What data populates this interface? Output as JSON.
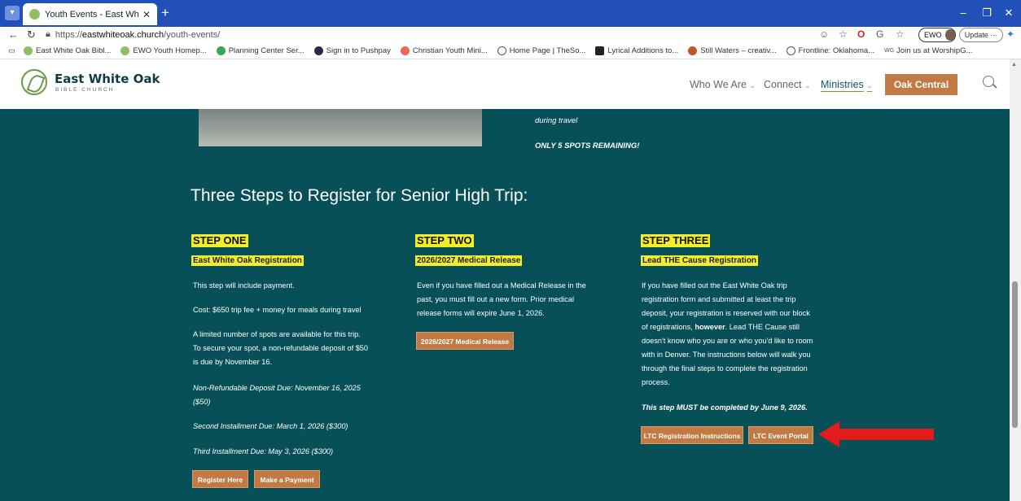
{
  "browser": {
    "tab_title": "Youth Events - East White Oak Bi...",
    "new_tab": "+",
    "url_prefix": "https://",
    "url_domain": "eastwhiteoak.church",
    "url_path": "/youth-events/",
    "profile": "EWO",
    "update_label": "Update",
    "bookmarks": [
      "East White Oak Bibl...",
      "EWO Youth Homep...",
      "Planning Center Ser...",
      "Sign in to Pushpay",
      "Christian Youth Mini...",
      "Home Page | TheSo...",
      "Lyrical Additions to...",
      "Still Waters – creativ...",
      "Frontline: Oklahoma...",
      "Join us at WorshipG..."
    ]
  },
  "site": {
    "logo_name": "East White Oak",
    "logo_sub": "BIBLE CHURCH",
    "nav": [
      "Who We Are",
      "Connect",
      "Ministries"
    ],
    "oak_central": "Oak Central"
  },
  "intro": {
    "travel": "during travel",
    "spots": "ONLY 5 SPOTS REMAINING!"
  },
  "section_title": "Three Steps to Register for Senior High Trip:",
  "steps": [
    {
      "heading": "STEP ONE",
      "subheading": "East White Oak Registration",
      "p1": "This step will include payment.",
      "p2": "Cost: $650 trip fee + money for meals during travel",
      "p3_l1": "A limited number of spots are available for this trip.",
      "p3_l2": "To secure your spot, a non-refundable deposit of $50",
      "p3_l3": "is due by November 16.",
      "due1_l1": "Non-Refundable Deposit Due: November 16, 2025",
      "due1_l2": "($50)",
      "due2": "Second Installment Due: March 1, 2026 ($300)",
      "due3": "Third Installment Due: May 3, 2026 ($300)",
      "btn1": "Register Here",
      "btn2": "Make a Payment"
    },
    {
      "heading": "STEP TWO",
      "subheading": "2026/2027 Medical Release",
      "l1": "Even if you have filled out a Medical Release in the",
      "l2": "past, you must fill out a new form. Prior medical",
      "l3": "release forms will expire June 1, 2026.",
      "btn": "2026/2027 Medical Release"
    },
    {
      "heading": "STEP THREE",
      "subheading": "Lead THE Cause Registration",
      "l1": "If you have filled out the East White Oak trip",
      "l2": "registration form and submitted at least the trip",
      "l3": "deposit, your registration is reserved with our block",
      "l4a": "of registrations, ",
      "l4b": "however",
      "l4c": ". Lead THE Cause still",
      "l5": "doesn't know who you are or who you'd like to room",
      "l6": "with in Denver. The instructions below will walk you",
      "l7": "through the final steps to complete the registration",
      "l8": "process.",
      "deadline": "This step MUST be completed by June 9, 2026.",
      "btn1": "LTC Registration Instructions",
      "btn2": "LTC Event Portal"
    }
  ],
  "colors": {
    "teal": "#075057",
    "accent": "#c27a45",
    "highlight": "#f2ef2a",
    "arrow": "#e31b1b"
  }
}
